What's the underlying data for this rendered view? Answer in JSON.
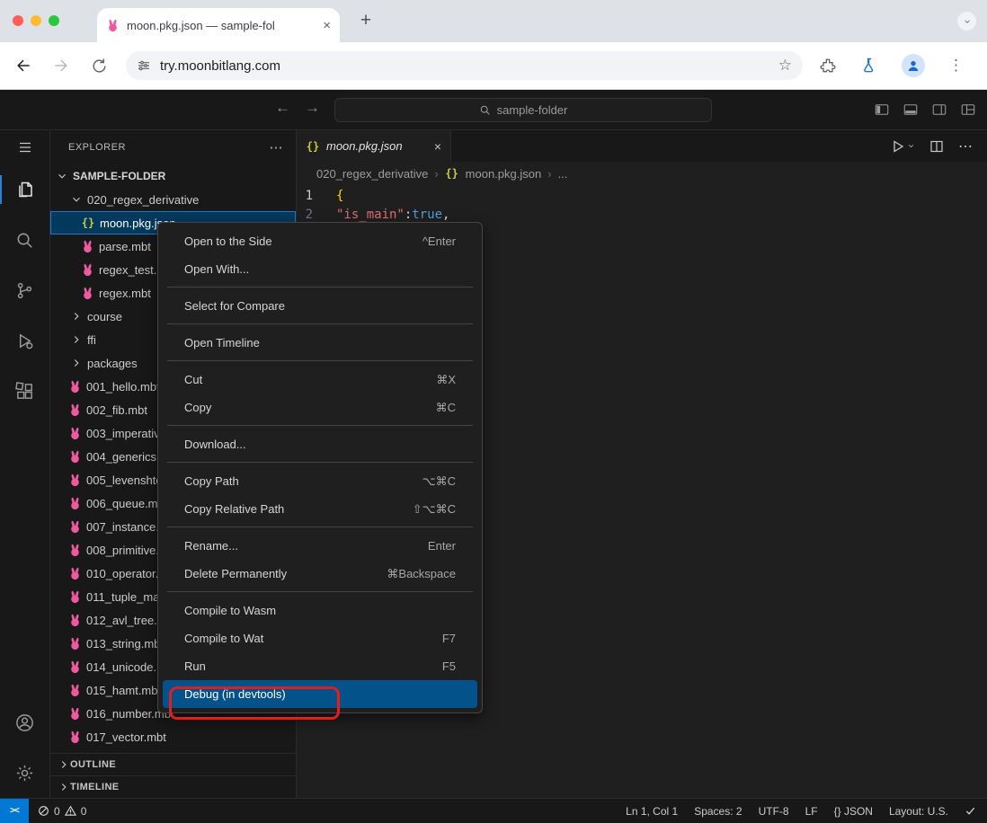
{
  "browser": {
    "tab_title": "moon.pkg.json — sample-fol",
    "url": "try.moonbitlang.com"
  },
  "titlebar": {
    "search_value": "sample-folder"
  },
  "explorer": {
    "title": "EXPLORER",
    "root": "SAMPLE-FOLDER",
    "items": [
      {
        "name": "020_regex_derivative"
      },
      {
        "name": "moon.pkg.json"
      },
      {
        "name": "parse.mbt"
      },
      {
        "name": "regex_test.mbt"
      },
      {
        "name": "regex.mbt"
      },
      {
        "name": "course"
      },
      {
        "name": "ffi"
      },
      {
        "name": "packages"
      },
      {
        "name": "001_hello.mbt"
      },
      {
        "name": "002_fib.mbt"
      },
      {
        "name": "003_imperative.mbt"
      },
      {
        "name": "004_generics.mbt"
      },
      {
        "name": "005_levenshtein.mbt"
      },
      {
        "name": "006_queue.mbt"
      },
      {
        "name": "007_instance.mbt"
      },
      {
        "name": "008_primitive.mbt"
      },
      {
        "name": "010_operator.mbt"
      },
      {
        "name": "011_tuple_map.mbt"
      },
      {
        "name": "012_avl_tree.mbt"
      },
      {
        "name": "013_string.mbt"
      },
      {
        "name": "014_unicode.mbt"
      },
      {
        "name": "015_hamt.mbt"
      },
      {
        "name": "016_number.mbt"
      },
      {
        "name": "017_vector.mbt"
      }
    ],
    "outline": "OUTLINE",
    "timeline": "TIMELINE"
  },
  "editor": {
    "tab": "moon.pkg.json",
    "breadcrumbs": [
      "020_regex_derivative",
      "moon.pkg.json",
      "..."
    ],
    "lines": [
      {
        "num": "1",
        "tokens": [
          {
            "t": "{"
          }
        ]
      },
      {
        "num": "2",
        "tokens": [
          {
            "t": "\"is_main\""
          },
          {
            "t": ": "
          },
          {
            "t": "true"
          },
          {
            "t": ","
          }
        ]
      }
    ]
  },
  "menu": {
    "items": [
      {
        "label": "Open to the Side",
        "key": "^Enter"
      },
      {
        "label": "Open With...",
        "key": ""
      },
      {
        "label": "Select for Compare",
        "key": ""
      },
      {
        "label": "Open Timeline",
        "key": ""
      },
      {
        "label": "Cut",
        "key": "⌘X"
      },
      {
        "label": "Copy",
        "key": "⌘C"
      },
      {
        "label": "Download...",
        "key": ""
      },
      {
        "label": "Copy Path",
        "key": "⌥⌘C"
      },
      {
        "label": "Copy Relative Path",
        "key": "⇧⌥⌘C"
      },
      {
        "label": "Rename...",
        "key": "Enter"
      },
      {
        "label": "Delete Permanently",
        "key": "⌘Backspace"
      },
      {
        "label": "Compile to Wasm",
        "key": ""
      },
      {
        "label": "Compile to Wat",
        "key": "F7"
      },
      {
        "label": "Run",
        "key": "F5"
      },
      {
        "label": "Debug (in devtools)",
        "key": ""
      }
    ]
  },
  "status": {
    "errors": "0",
    "warnings": "0",
    "right": [
      "Ln 1, Col 1",
      "Spaces: 2",
      "UTF-8",
      "LF",
      "{} JSON",
      "Layout: U.S."
    ]
  },
  "glyphs": {
    "close": "×",
    "plus": "+",
    "kebab": "⋮",
    "ellipsis": "⋯",
    "back": "←",
    "forward": "→",
    "star": "☆",
    "crumb_sep": "›",
    "braces": "{}",
    "remote": "><"
  },
  "colors": {
    "accent": "#0078d4",
    "selection": "#04395e",
    "annotation": "#e11d1d",
    "rabbit": "#ee5aa0"
  }
}
